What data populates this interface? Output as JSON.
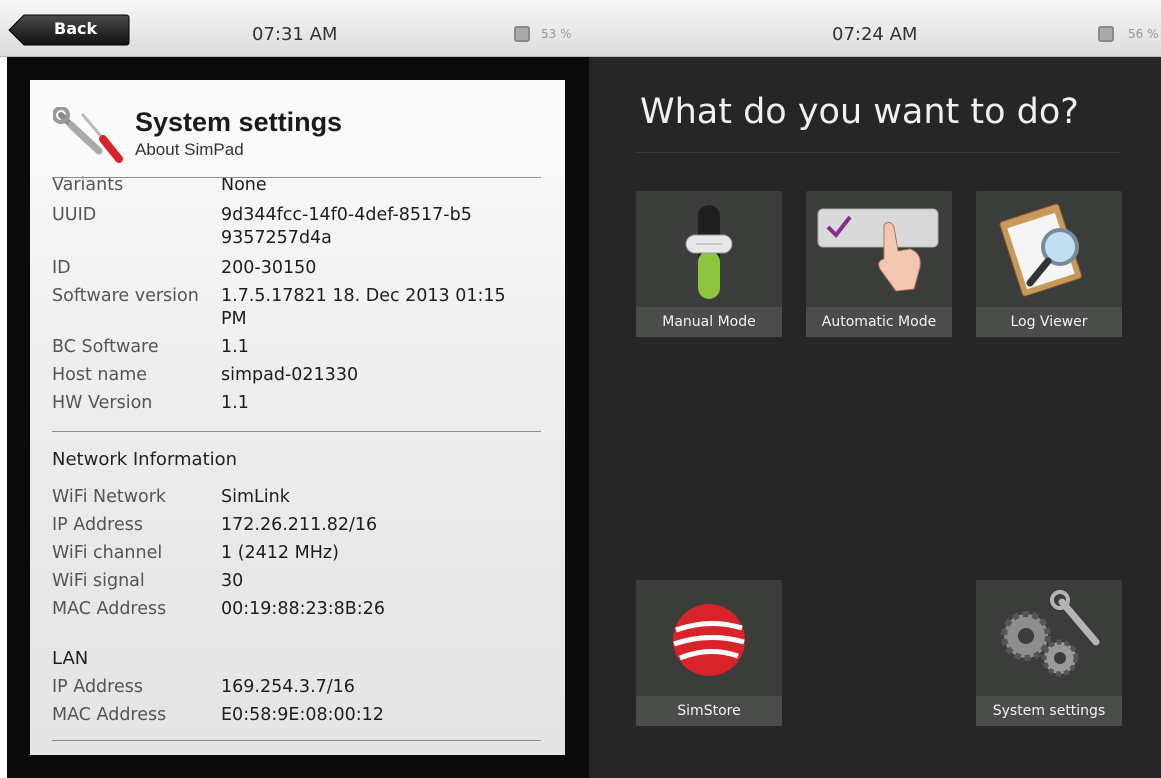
{
  "statusbar": {
    "back_label": "Back",
    "left_time": "07:31 AM",
    "left_battery": "53 %",
    "right_time": "07:24 AM",
    "right_battery": "56 %"
  },
  "about": {
    "title": "System settings",
    "subtitle": "About SimPad",
    "partial_row": {
      "key": "Variants",
      "value": "None"
    },
    "rows": [
      {
        "key": "UUID",
        "value": "9d344fcc-14f0-4def-8517-b59357257d4a"
      },
      {
        "key": "ID",
        "value": "200-30150"
      },
      {
        "key": "Software version",
        "value": "1.7.5.17821 18. Dec 2013 01:15 PM"
      },
      {
        "key": "BC Software",
        "value": "1.1"
      },
      {
        "key": "Host name",
        "value": "simpad-021330"
      },
      {
        "key": "HW Version",
        "value": "1.1"
      }
    ],
    "network_heading": "Network Information",
    "network": [
      {
        "key": "WiFi Network",
        "value": "SimLink"
      },
      {
        "key": "IP Address",
        "value": "172.26.211.82/16"
      },
      {
        "key": "WiFi channel",
        "value": "1 (2412 MHz)"
      },
      {
        "key": "WiFi signal",
        "value": "30"
      },
      {
        "key": "MAC Address",
        "value": "00:19:88:23:8B:26"
      }
    ],
    "lan_heading": "LAN",
    "lan": [
      {
        "key": "IP Address",
        "value": "169.254.3.7/16"
      },
      {
        "key": "MAC Address",
        "value": "E0:58:9E:08:00:12"
      }
    ]
  },
  "menu": {
    "question": "What do you want to do?",
    "tiles": {
      "manual": "Manual Mode",
      "automatic": "Automatic Mode",
      "log": "Log Viewer",
      "simstore": "SimStore",
      "settings": "System settings"
    }
  },
  "colors": {
    "accent_green": "#8cc63f",
    "simstore_red": "#d8232a",
    "check_purple": "#8a2b8f"
  }
}
